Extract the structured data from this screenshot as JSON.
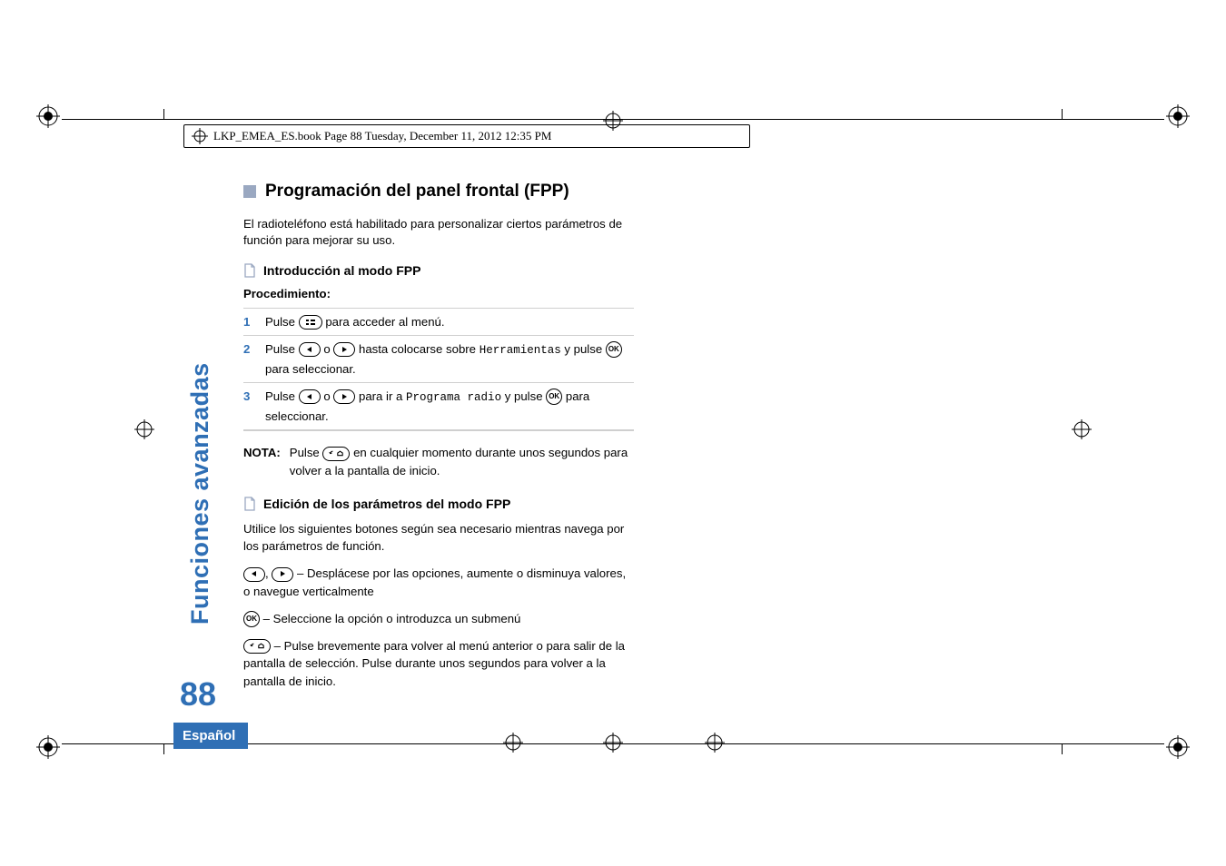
{
  "slug": "LKP_EMEA_ES.book  Page 88  Tuesday, December 11, 2012  12:35 PM",
  "heading1": "Programación del panel frontal (FPP)",
  "intro": "El radioteléfono está habilitado para personalizar ciertos parámetros de función para mejorar su uso.",
  "section1": {
    "title": "Introducción al modo FPP",
    "procedure_label": "Procedimiento:",
    "steps": {
      "n1": "1",
      "s1a": "Pulse ",
      "s1b": " para acceder al menú.",
      "n2": "2",
      "s2a": "Pulse ",
      "s2b": " o ",
      "s2c": " hasta colocarse sobre ",
      "s2d": "Herramientas",
      "s2e": " y pulse ",
      "s2f": " para seleccionar.",
      "n3": "3",
      "s3a": "Pulse ",
      "s3b": " o ",
      "s3c": " para ir a ",
      "s3d": "Programa radio",
      "s3e": " y pulse ",
      "s3f": " para seleccionar."
    },
    "note_label": "NOTA:",
    "note_a": "Pulse ",
    "note_b": " en cualquier momento durante unos segundos para volver a la pantalla de inicio."
  },
  "section2": {
    "title": "Edición de los parámetros del modo FPP",
    "lead": "Utilice los siguientes botones según sea necesario mientras navega por los parámetros de función.",
    "b1": " – Desplácese por las opciones, aumente o disminuya valores, o navegue verticalmente",
    "b1_sep": ", ",
    "b2": " – Seleccione la opción o introduzca un submenú",
    "b3": " – Pulse brevemente para volver al menú anterior o para salir de la pantalla de selección. Pulse durante unos segundos para volver a la pantalla de inicio."
  },
  "side_label": "Funciones avanzadas",
  "page_number": "88",
  "language": "Español",
  "keys": {
    "ok": "OK"
  }
}
